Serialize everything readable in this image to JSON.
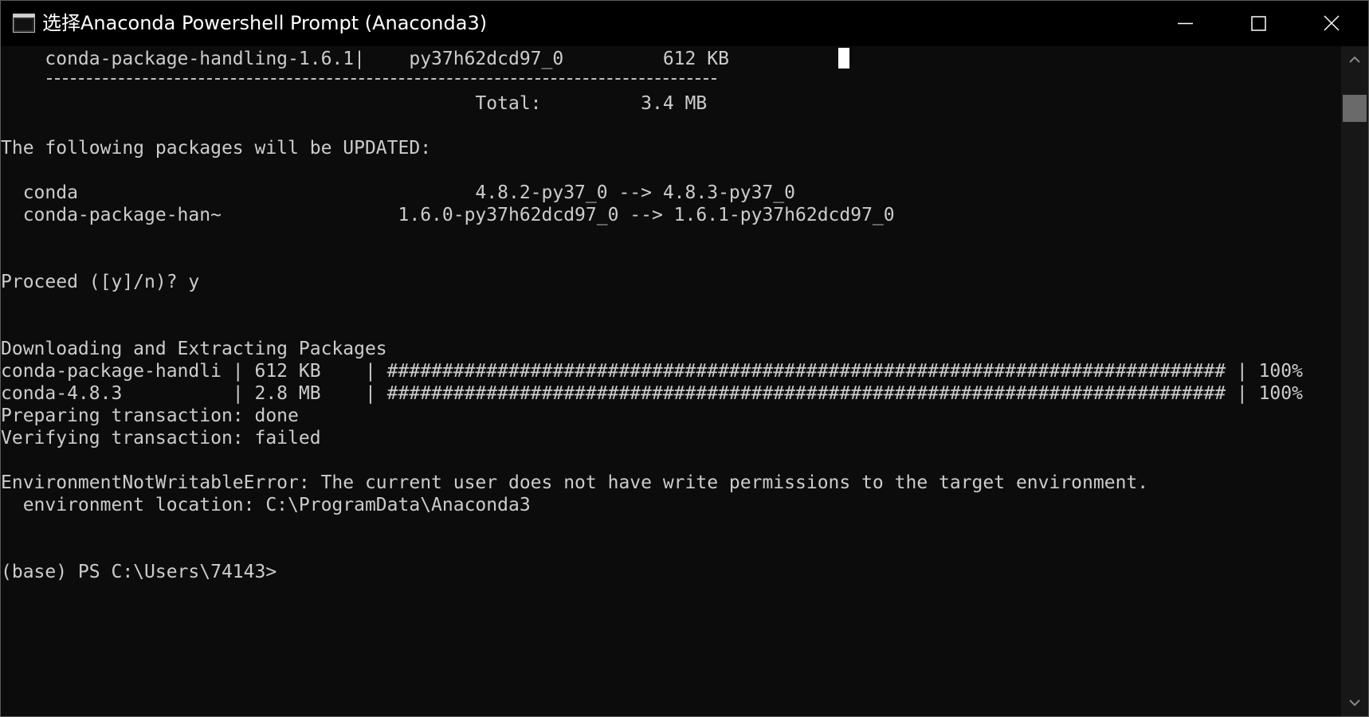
{
  "window": {
    "title": "选择Anaconda Powershell Prompt (Anaconda3)"
  },
  "icons": {
    "app": "console-app-icon",
    "minimize": "minimize-icon",
    "maximize": "maximize-icon",
    "close": "close-icon",
    "scroll_up": "chevron-up-icon",
    "scroll_down": "chevron-down-icon"
  },
  "colors": {
    "titlebar_bg": "#000000",
    "console_bg": "#0c0c0c",
    "console_text": "#cccccc",
    "cursor": "#ffffff",
    "scrollbar_bg": "#171717",
    "scroll_thumb": "#6a6a6a"
  },
  "console": {
    "lines": [
      "    conda-package-handling-1.6.1|    py37h62dcd97_0         612 KB",
      "                                           Total:         3.4 MB",
      "",
      "The following packages will be UPDATED:",
      "",
      "  conda                                    4.8.2-py37_0 --> 4.8.3-py37_0",
      "  conda-package-han~                1.6.0-py37h62dcd97_0 --> 1.6.1-py37h62dcd97_0",
      "",
      "",
      "Proceed ([y]/n)? y",
      "",
      "",
      "Downloading and Extracting Packages",
      "conda-package-handli | 612 KB    | ############################################################################ | 100%",
      "conda-4.8.3          | 2.8 MB    | ############################################################################ | 100%",
      "Preparing transaction: done",
      "Verifying transaction: failed",
      "",
      "EnvironmentNotWritableError: The current user does not have write permissions to the target environment.",
      "  environment location: C:\\ProgramData\\Anaconda3",
      "",
      "",
      "(base) PS C:\\Users\\74143>"
    ]
  }
}
